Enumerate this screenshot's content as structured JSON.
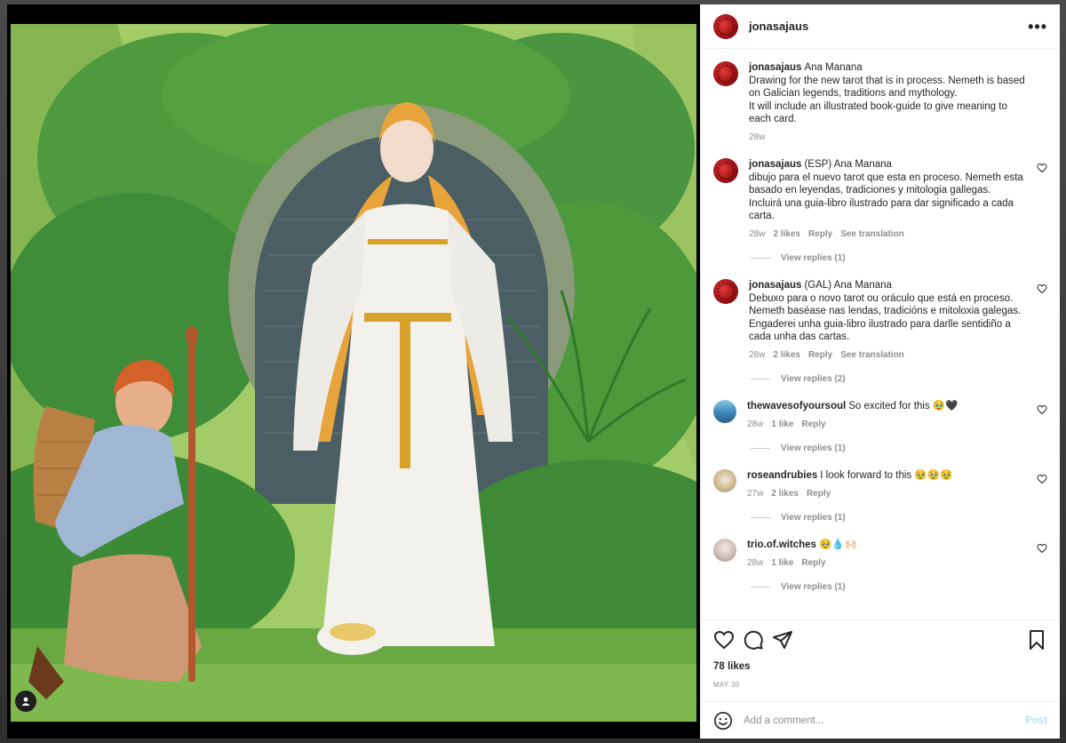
{
  "post": {
    "username": "jonasajaus",
    "likes": "78 likes",
    "date": "MAY 30",
    "add_comment_placeholder": "Add a comment...",
    "post_label": "Post"
  },
  "icons": {
    "more": "more-options-icon",
    "like": "heart-icon",
    "comment": "comment-icon",
    "share": "share-icon",
    "save": "bookmark-icon",
    "emoji": "emoji-icon",
    "user_tag": "user-tag-icon"
  },
  "comments": [
    {
      "user": "jonasajaus",
      "text": "Ana Manana\nDrawing for the new tarot that is in process. Nemeth is based on Galician legends, traditions and mythology.\nIt will include an illustrated book-guide to give meaning to each card.",
      "time": "28w"
    },
    {
      "user": "jonasajaus",
      "text": "(ESP) Ana Manana\ndibujo para el nuevo tarot que esta en proceso. Nemeth esta basado en leyendas, tradiciones y mitologia gallegas.\nIncluirá una guia-libro ilustrado para dar significado a cada carta.",
      "time": "28w",
      "likes": "2 likes",
      "reply": "Reply",
      "translate": "See translation",
      "view_replies": "View replies (1)"
    },
    {
      "user": "jonasajaus",
      "text": "(GAL) Ana Manana\nDebuxo para o novo tarot ou oráculo que está en proceso. Nemeth baséase nas lendas, tradicións e mitoloxia galegas.\nEngaderei unha guia-libro ilustrado para darlle sentidiño a cada unha das cartas.",
      "time": "28w",
      "likes": "2 likes",
      "reply": "Reply",
      "translate": "See translation",
      "view_replies": "View replies (2)"
    },
    {
      "user": "thewavesofyoursoul",
      "text": "So excited for this 🥹🖤",
      "time": "28w",
      "likes": "1 like",
      "reply": "Reply",
      "view_replies": "View replies (1)"
    },
    {
      "user": "roseandrubies",
      "text": "I look forward to this 🥹🥹🥹",
      "time": "27w",
      "likes": "2 likes",
      "reply": "Reply",
      "view_replies": "View replies (1)"
    },
    {
      "user": "trio.of.witches",
      "text": "🥹💧🙌🏻",
      "time": "28w",
      "likes": "1 like",
      "reply": "Reply",
      "view_replies": "View replies (1)"
    }
  ]
}
